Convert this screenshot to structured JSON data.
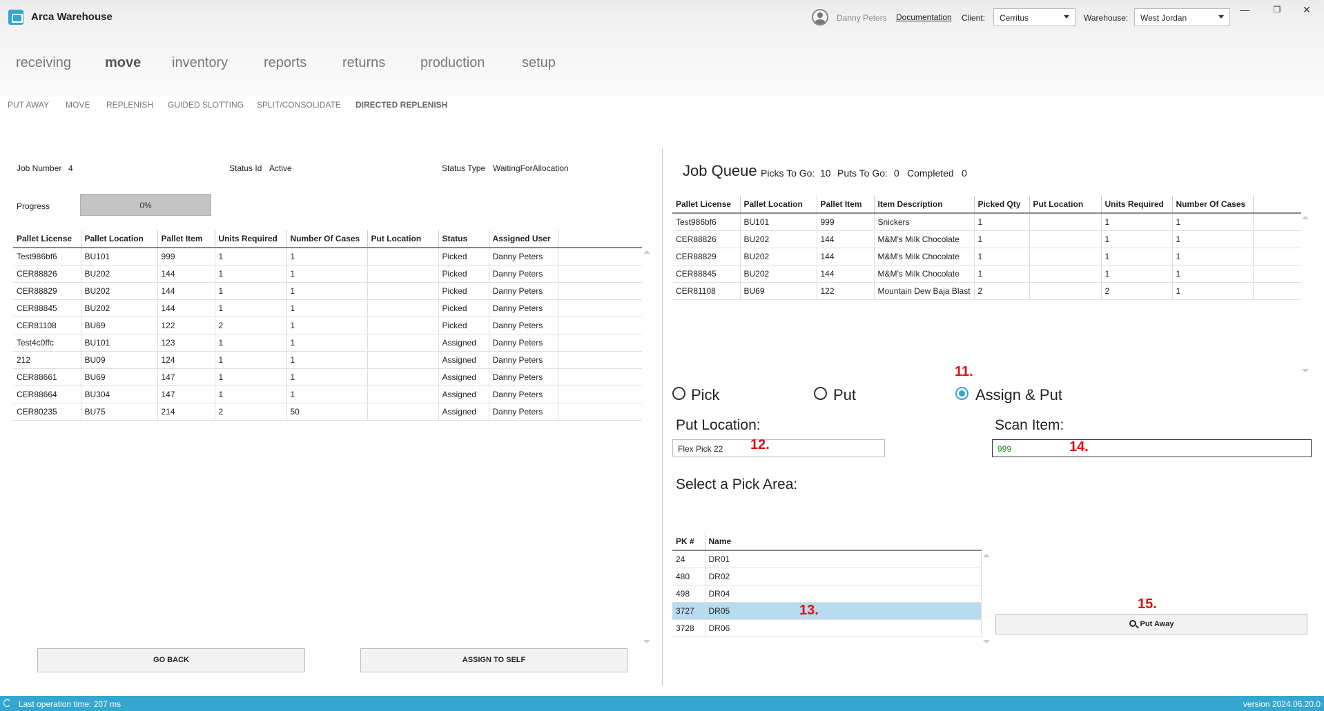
{
  "app": {
    "title": "Arca Warehouse",
    "user": "Danny Peters",
    "documentation": "Documentation",
    "client_label": "Client:",
    "client_value": "Cerritus",
    "warehouse_label": "Warehouse:",
    "warehouse_value": "West Jordan",
    "minimize": "—",
    "restore": "❐",
    "close": "✕"
  },
  "nav": [
    "receiving",
    "move",
    "inventory",
    "reports",
    "returns",
    "production",
    "setup"
  ],
  "subnav": [
    "PUT AWAY",
    "MOVE",
    "REPLENISH",
    "GUIDED SLOTTING",
    "SPLIT/CONSOLIDATE",
    "DIRECTED REPLENISH"
  ],
  "job": {
    "number_label": "Job Number",
    "number": "4",
    "status_id_label": "Status Id",
    "status_id": "Active",
    "status_type_label": "Status Type",
    "status_type": "WaitingForAllocation",
    "progress_label": "Progress",
    "progress_text": "0%",
    "progress_value": 0
  },
  "job_table": {
    "headers": [
      "Pallet License",
      "Pallet Location",
      "Pallet Item",
      "Units Required",
      "Number Of Cases",
      "Put Location",
      "Status",
      "Assigned User"
    ],
    "rows": [
      [
        "Test986bf6",
        "BU101",
        "999",
        "1",
        "1",
        "",
        "Picked",
        "Danny Peters"
      ],
      [
        "CER88826",
        "BU202",
        "144",
        "1",
        "1",
        "",
        "Picked",
        "Danny Peters"
      ],
      [
        "CER88829",
        "BU202",
        "144",
        "1",
        "1",
        "",
        "Picked",
        "Danny Peters"
      ],
      [
        "CER88845",
        "BU202",
        "144",
        "1",
        "1",
        "",
        "Picked",
        "Danny Peters"
      ],
      [
        "CER81108",
        "BU69",
        "122",
        "2",
        "1",
        "",
        "Picked",
        "Danny Peters"
      ],
      [
        "Test4c0ffc",
        "BU101",
        "123",
        "1",
        "1",
        "",
        "Assigned",
        "Danny Peters"
      ],
      [
        "212",
        "BU09",
        "124",
        "1",
        "1",
        "",
        "Assigned",
        "Danny Peters"
      ],
      [
        "CER88661",
        "BU69",
        "147",
        "1",
        "1",
        "",
        "Assigned",
        "Danny Peters"
      ],
      [
        "CER88664",
        "BU304",
        "147",
        "1",
        "1",
        "",
        "Assigned",
        "Danny Peters"
      ],
      [
        "CER80235",
        "BU75",
        "214",
        "2",
        "50",
        "",
        "Assigned",
        "Danny Peters"
      ]
    ]
  },
  "buttons": {
    "go_back": "GO BACK",
    "assign_to_self": "ASSIGN TO SELF",
    "put_away": "Put Away"
  },
  "queue": {
    "title": "Job Queue",
    "picks_label": "Picks To Go:",
    "picks": "10",
    "puts_label": "Puts To Go:",
    "puts": "0",
    "completed_label": "Completed",
    "completed": "0",
    "headers": [
      "Pallet License",
      "Pallet Location",
      "Pallet Item",
      "Item Description",
      "Picked Qty",
      "Put Location",
      "Units Required",
      "Number Of Cases"
    ],
    "rows": [
      [
        "Test986bf6",
        "BU101",
        "999",
        "Snickers",
        "1",
        "",
        "1",
        "1"
      ],
      [
        "CER88826",
        "BU202",
        "144",
        "M&M's Milk Chocolate",
        "1",
        "",
        "1",
        "1"
      ],
      [
        "CER88829",
        "BU202",
        "144",
        "M&M's Milk Chocolate",
        "1",
        "",
        "1",
        "1"
      ],
      [
        "CER88845",
        "BU202",
        "144",
        "M&M's Milk Chocolate",
        "1",
        "",
        "1",
        "1"
      ],
      [
        "CER81108",
        "BU69",
        "122",
        "Mountain Dew Baja Blast",
        "2",
        "",
        "2",
        "1"
      ]
    ]
  },
  "mode": {
    "pick": "Pick",
    "put": "Put",
    "assign_put": "Assign & Put",
    "selected": "assign_put"
  },
  "put_location": {
    "label": "Put Location:",
    "value": "Flex Pick 22"
  },
  "scan_item": {
    "label": "Scan Item:",
    "value": "999"
  },
  "pick_area": {
    "label": "Select a Pick Area:",
    "headers": [
      "PK #",
      "Name"
    ],
    "rows": [
      [
        "24",
        "DR01"
      ],
      [
        "480",
        "DR02"
      ],
      [
        "498",
        "DR04"
      ],
      [
        "3727",
        "DR05"
      ],
      [
        "3728",
        "DR06"
      ]
    ],
    "selected_index": 3
  },
  "annotations": [
    "11.",
    "12.",
    "13.",
    "14.",
    "15."
  ],
  "status_bar": {
    "text": "Last operation time:  207 ms",
    "version": "version 2024.06.20.0"
  },
  "colors": {
    "accent": "#35a6cf",
    "annotation": "#dd1111",
    "selected_row": "#b6dcee"
  }
}
